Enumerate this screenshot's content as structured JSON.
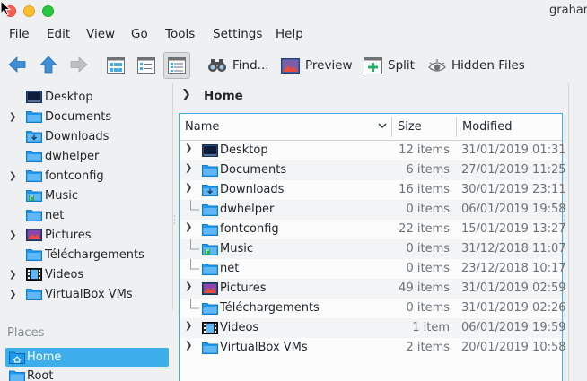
{
  "window": {
    "title": "grahan"
  },
  "menu": [
    {
      "label": "File",
      "accel": "F",
      "rest": "ile"
    },
    {
      "label": "Edit",
      "accel": "E",
      "rest": "dit"
    },
    {
      "label": "View",
      "accel": "V",
      "rest": "iew"
    },
    {
      "label": "Go",
      "accel": "G",
      "rest": "o"
    },
    {
      "label": "Tools",
      "accel": "T",
      "rest": "ools"
    },
    {
      "label": "Settings",
      "accel": "S",
      "rest": "ettings"
    },
    {
      "label": "Help",
      "accel": "H",
      "rest": "elp"
    }
  ],
  "toolbar": {
    "find_label": "Find...",
    "preview_label": "Preview",
    "split_label": "Split",
    "hidden_files_label": "Hidden Files"
  },
  "folders_panel": {
    "items": [
      {
        "label": "Desktop",
        "expandable": false,
        "icon": "desktop-folder-icon"
      },
      {
        "label": "Documents",
        "expandable": true,
        "icon": "folder-icon"
      },
      {
        "label": "Downloads",
        "expandable": false,
        "icon": "downloads-folder-icon"
      },
      {
        "label": "dwhelper",
        "expandable": false,
        "icon": "folder-icon"
      },
      {
        "label": "fontconfig",
        "expandable": true,
        "icon": "folder-icon"
      },
      {
        "label": "Music",
        "expandable": false,
        "icon": "music-folder-icon"
      },
      {
        "label": "net",
        "expandable": false,
        "icon": "folder-icon"
      },
      {
        "label": "Pictures",
        "expandable": true,
        "icon": "pictures-folder-icon"
      },
      {
        "label": "Téléchargements",
        "expandable": false,
        "icon": "folder-icon"
      },
      {
        "label": "Videos",
        "expandable": true,
        "icon": "videos-folder-icon"
      },
      {
        "label": "VirtualBox VMs",
        "expandable": true,
        "icon": "folder-icon"
      }
    ]
  },
  "places": {
    "title": "Places",
    "items": [
      {
        "label": "Home",
        "selected": true,
        "icon": "home-icon"
      },
      {
        "label": "Root",
        "selected": false,
        "icon": "root-folder-icon"
      }
    ]
  },
  "breadcrumb": {
    "current": "Home"
  },
  "file_view": {
    "columns": {
      "name": "Name",
      "size": "Size",
      "modified": "Modified"
    },
    "rows": [
      {
        "name": "Desktop",
        "size": "12 items",
        "modified": "31/01/2019 01:31",
        "expandable": true,
        "icon": "desktop-folder-icon"
      },
      {
        "name": "Documents",
        "size": "6 items",
        "modified": "27/01/2019 11:25",
        "expandable": true,
        "icon": "folder-icon"
      },
      {
        "name": "Downloads",
        "size": "16 items",
        "modified": "30/01/2019 23:11",
        "expandable": true,
        "icon": "downloads-folder-icon"
      },
      {
        "name": "dwhelper",
        "size": "0 items",
        "modified": "06/01/2019 19:58",
        "expandable": false,
        "icon": "folder-icon"
      },
      {
        "name": "fontconfig",
        "size": "22 items",
        "modified": "15/01/2019 13:27",
        "expandable": true,
        "icon": "folder-icon"
      },
      {
        "name": "Music",
        "size": "0 items",
        "modified": "31/12/2018 11:07",
        "expandable": false,
        "icon": "music-folder-icon"
      },
      {
        "name": "net",
        "size": "0 items",
        "modified": "23/12/2018 10:17",
        "expandable": false,
        "icon": "folder-icon"
      },
      {
        "name": "Pictures",
        "size": "49 items",
        "modified": "31/01/2019 02:59",
        "expandable": true,
        "icon": "pictures-folder-icon"
      },
      {
        "name": "Téléchargements",
        "size": "0 items",
        "modified": "31/01/2019 02:26",
        "expandable": false,
        "icon": "folder-icon"
      },
      {
        "name": "Videos",
        "size": "1 item",
        "modified": "06/01/2019 19:59",
        "expandable": true,
        "icon": "videos-folder-icon"
      },
      {
        "name": "VirtualBox VMs",
        "size": "2 items",
        "modified": "20/01/2019 10:58",
        "expandable": true,
        "icon": "folder-icon"
      }
    ]
  },
  "colors": {
    "accent": "#3daee9",
    "folder_blue": "#1d99f3",
    "window_bg": "#eff0f1",
    "view_bg": "#fcfcfc"
  }
}
